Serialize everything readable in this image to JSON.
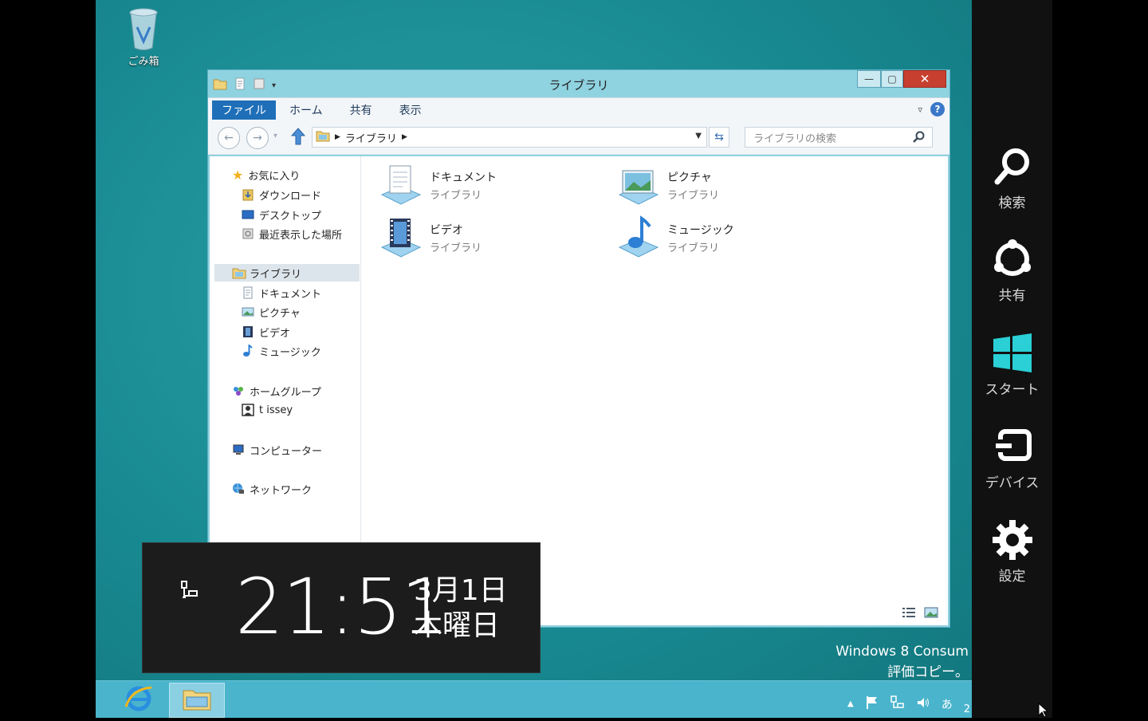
{
  "desktop": {
    "recycle_bin_label": "ごみ箱",
    "watermark_line1": "Windows 8 Consum",
    "watermark_line2": "評価コピー。"
  },
  "explorer": {
    "title": "ライブラリ",
    "ribbon_tabs": [
      "ファイル",
      "ホーム",
      "共有",
      "表示"
    ],
    "address": {
      "crumb": "ライブラリ"
    },
    "search": {
      "placeholder": "ライブラリの検索"
    },
    "nav": {
      "favorites": "お気に入り",
      "downloads": "ダウンロード",
      "desktop": "デスクトップ",
      "recent": "最近表示した場所",
      "libraries": "ライブラリ",
      "documents": "ドキュメント",
      "pictures": "ピクチャ",
      "videos": "ビデオ",
      "music": "ミュージック",
      "homegroup": "ホームグループ",
      "user": "t issey",
      "computer": "コンピューター",
      "network": "ネットワーク"
    },
    "items": [
      {
        "name": "ドキュメント",
        "type": "ライブラリ"
      },
      {
        "name": "ピクチャ",
        "type": "ライブラリ"
      },
      {
        "name": "ビデオ",
        "type": "ライブラリ"
      },
      {
        "name": "ミュージック",
        "type": "ライブラリ"
      }
    ]
  },
  "clock": {
    "time": "21:51",
    "date_line1": "3月1日",
    "date_line2": "木曜日"
  },
  "charms": {
    "search": "検索",
    "share": "共有",
    "start": "スタート",
    "devices": "デバイス",
    "settings": "設定"
  },
  "taskbar": {
    "ime": "あ",
    "clock_fragment": "2"
  },
  "colors": {
    "desktop": "#198a92",
    "taskbar": "#4ab4cc",
    "charms": "#111111",
    "file_tab": "#1e6fb8",
    "close": "#c7402f"
  }
}
